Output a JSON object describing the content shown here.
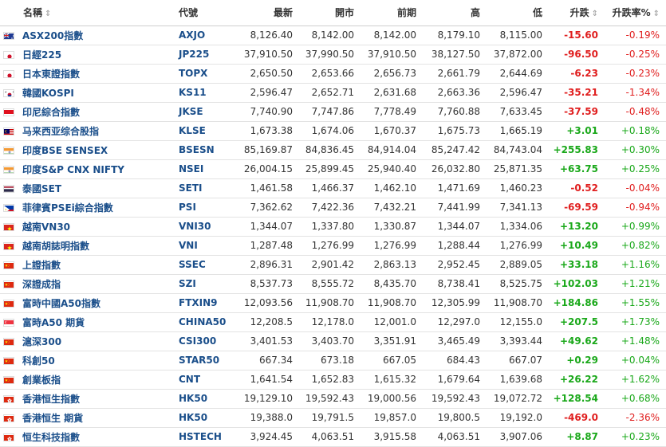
{
  "header": {
    "name": "名稱",
    "code": "代號",
    "last": "最新",
    "open": "開市",
    "prev": "前期",
    "high": "高",
    "low": "低",
    "chg": "升跌",
    "chg_pct": "升跌率%",
    "sort_icon": "⇕"
  },
  "colors": {
    "up": "#1aa81a",
    "down": "#e01e1e",
    "link": "#1a4e8a"
  },
  "rows": [
    {
      "flag": "australia-flag-icon",
      "name": "ASX200指數",
      "code": "AXJO",
      "last": "8,126.40",
      "open": "8,142.00",
      "prev": "8,142.00",
      "high": "8,179.10",
      "low": "8,115.00",
      "chg": "-15.60",
      "pct": "-0.19%",
      "dir": "down"
    },
    {
      "flag": "japan-flag-icon",
      "name": "日經225",
      "code": "JP225",
      "last": "37,910.50",
      "open": "37,990.50",
      "prev": "37,910.50",
      "high": "38,127.50",
      "low": "37,872.00",
      "chg": "-96.50",
      "pct": "-0.25%",
      "dir": "down"
    },
    {
      "flag": "japan-flag-icon",
      "name": "日本東證指數",
      "code": "TOPX",
      "last": "2,650.50",
      "open": "2,653.66",
      "prev": "2,656.73",
      "high": "2,661.79",
      "low": "2,644.69",
      "chg": "-6.23",
      "pct": "-0.23%",
      "dir": "down"
    },
    {
      "flag": "south-korea-flag-icon",
      "name": "韓國KOSPI",
      "code": "KS11",
      "last": "2,596.47",
      "open": "2,652.71",
      "prev": "2,631.68",
      "high": "2,663.36",
      "low": "2,596.47",
      "chg": "-35.21",
      "pct": "-1.34%",
      "dir": "down"
    },
    {
      "flag": "indonesia-flag-icon",
      "name": "印尼綜合指數",
      "code": "JKSE",
      "last": "7,740.90",
      "open": "7,747.86",
      "prev": "7,778.49",
      "high": "7,760.88",
      "low": "7,633.45",
      "chg": "-37.59",
      "pct": "-0.48%",
      "dir": "down"
    },
    {
      "flag": "malaysia-flag-icon",
      "name": "马来西亚综合股指",
      "code": "KLSE",
      "last": "1,673.38",
      "open": "1,674.06",
      "prev": "1,670.37",
      "high": "1,675.73",
      "low": "1,665.19",
      "chg": "+3.01",
      "pct": "+0.18%",
      "dir": "up"
    },
    {
      "flag": "india-flag-icon",
      "name": "印度BSE SENSEX",
      "code": "BSESN",
      "last": "85,169.87",
      "open": "84,836.45",
      "prev": "84,914.04",
      "high": "85,247.42",
      "low": "84,743.04",
      "chg": "+255.83",
      "pct": "+0.30%",
      "dir": "up"
    },
    {
      "flag": "india-flag-icon",
      "name": "印度S&P CNX NIFTY",
      "code": "NSEI",
      "last": "26,004.15",
      "open": "25,899.45",
      "prev": "25,940.40",
      "high": "26,032.80",
      "low": "25,871.35",
      "chg": "+63.75",
      "pct": "+0.25%",
      "dir": "up"
    },
    {
      "flag": "thailand-flag-icon",
      "name": "泰國SET",
      "code": "SETI",
      "last": "1,461.58",
      "open": "1,466.37",
      "prev": "1,462.10",
      "high": "1,471.69",
      "low": "1,460.23",
      "chg": "-0.52",
      "pct": "-0.04%",
      "dir": "down"
    },
    {
      "flag": "philippines-flag-icon",
      "name": "菲律賓PSEi綜合指數",
      "code": "PSI",
      "last": "7,362.62",
      "open": "7,422.36",
      "prev": "7,432.21",
      "high": "7,441.99",
      "low": "7,341.13",
      "chg": "-69.59",
      "pct": "-0.94%",
      "dir": "down"
    },
    {
      "flag": "vietnam-flag-icon",
      "name": "越南VN30",
      "code": "VNI30",
      "last": "1,344.07",
      "open": "1,337.80",
      "prev": "1,330.87",
      "high": "1,344.07",
      "low": "1,334.06",
      "chg": "+13.20",
      "pct": "+0.99%",
      "dir": "up"
    },
    {
      "flag": "vietnam-flag-icon",
      "name": "越南胡誌明指數",
      "code": "VNI",
      "last": "1,287.48",
      "open": "1,276.99",
      "prev": "1,276.99",
      "high": "1,288.44",
      "low": "1,276.99",
      "chg": "+10.49",
      "pct": "+0.82%",
      "dir": "up"
    },
    {
      "flag": "china-flag-icon",
      "name": "上證指數",
      "code": "SSEC",
      "last": "2,896.31",
      "open": "2,901.42",
      "prev": "2,863.13",
      "high": "2,952.45",
      "low": "2,889.05",
      "chg": "+33.18",
      "pct": "+1.16%",
      "dir": "up"
    },
    {
      "flag": "china-flag-icon",
      "name": "深證成指",
      "code": "SZI",
      "last": "8,537.73",
      "open": "8,555.72",
      "prev": "8,435.70",
      "high": "8,738.41",
      "low": "8,525.75",
      "chg": "+102.03",
      "pct": "+1.21%",
      "dir": "up"
    },
    {
      "flag": "china-flag-icon",
      "name": "富時中國A50指數",
      "code": "FTXIN9",
      "last": "12,093.56",
      "open": "11,908.70",
      "prev": "11,908.70",
      "high": "12,305.99",
      "low": "11,908.70",
      "chg": "+184.86",
      "pct": "+1.55%",
      "dir": "up"
    },
    {
      "flag": "singapore-flag-icon",
      "name": "富時A50 期貨",
      "code": "CHINA50",
      "last": "12,208.5",
      "open": "12,178.0",
      "prev": "12,001.0",
      "high": "12,297.0",
      "low": "12,155.0",
      "chg": "+207.5",
      "pct": "+1.73%",
      "dir": "up"
    },
    {
      "flag": "china-flag-icon",
      "name": "滬深300",
      "code": "CSI300",
      "last": "3,401.53",
      "open": "3,403.70",
      "prev": "3,351.91",
      "high": "3,465.49",
      "low": "3,393.44",
      "chg": "+49.62",
      "pct": "+1.48%",
      "dir": "up"
    },
    {
      "flag": "china-flag-icon",
      "name": "科創50",
      "code": "STAR50",
      "last": "667.34",
      "open": "673.18",
      "prev": "667.05",
      "high": "684.43",
      "low": "667.07",
      "chg": "+0.29",
      "pct": "+0.04%",
      "dir": "up"
    },
    {
      "flag": "china-flag-icon",
      "name": "創業板指",
      "code": "CNT",
      "last": "1,641.54",
      "open": "1,652.83",
      "prev": "1,615.32",
      "high": "1,679.64",
      "low": "1,639.68",
      "chg": "+26.22",
      "pct": "+1.62%",
      "dir": "up"
    },
    {
      "flag": "hong-kong-flag-icon",
      "name": "香港恒生指數",
      "code": "HK50",
      "last": "19,129.10",
      "open": "19,592.43",
      "prev": "19,000.56",
      "high": "19,592.43",
      "low": "19,072.72",
      "chg": "+128.54",
      "pct": "+0.68%",
      "dir": "up"
    },
    {
      "flag": "hong-kong-flag-icon",
      "name": "香港恒生 期貨",
      "code": "HK50",
      "last": "19,388.0",
      "open": "19,791.5",
      "prev": "19,857.0",
      "high": "19,800.5",
      "low": "19,192.0",
      "chg": "-469.0",
      "pct": "-2.36%",
      "dir": "down"
    },
    {
      "flag": "hong-kong-flag-icon",
      "name": "恒生科技指數",
      "code": "HSTECH",
      "last": "3,924.45",
      "open": "4,063.51",
      "prev": "3,915.58",
      "high": "4,063.51",
      "low": "3,907.06",
      "chg": "+8.87",
      "pct": "+0.23%",
      "dir": "up"
    }
  ]
}
